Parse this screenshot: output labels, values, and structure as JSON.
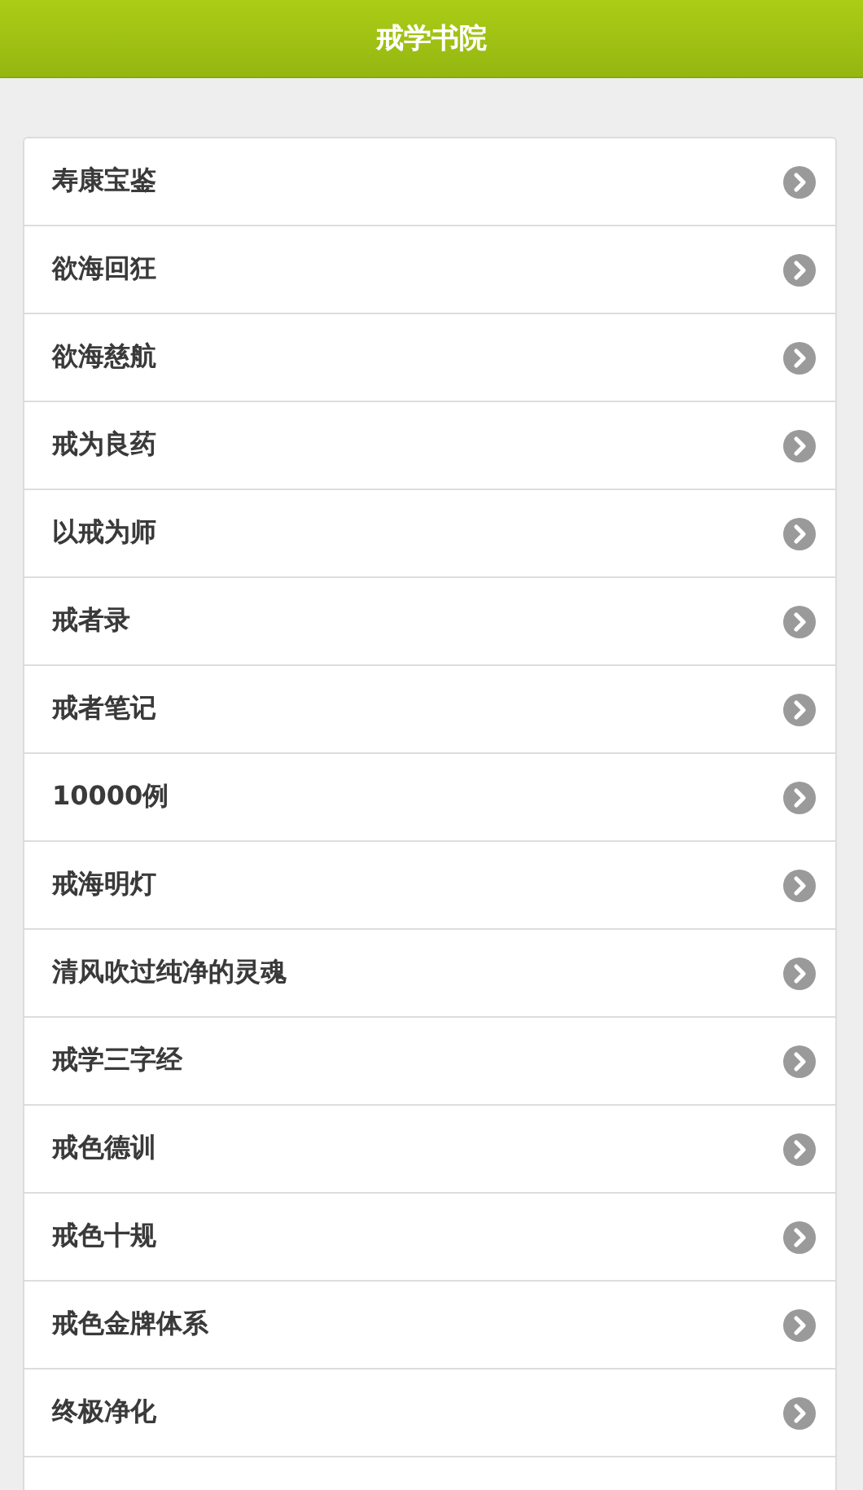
{
  "header": {
    "title": "戒学书院"
  },
  "menu_items": [
    {
      "label": "寿康宝鉴"
    },
    {
      "label": "欲海回狂"
    },
    {
      "label": "欲海慈航"
    },
    {
      "label": "戒为良药"
    },
    {
      "label": "以戒为师"
    },
    {
      "label": "戒者录"
    },
    {
      "label": "戒者笔记"
    },
    {
      "label": "10000例"
    },
    {
      "label": "戒海明灯"
    },
    {
      "label": "清风吹过纯净的灵魂"
    },
    {
      "label": "戒学三字经"
    },
    {
      "label": "戒色德训"
    },
    {
      "label": "戒色十规"
    },
    {
      "label": "戒色金牌体系"
    },
    {
      "label": "终极净化"
    }
  ]
}
